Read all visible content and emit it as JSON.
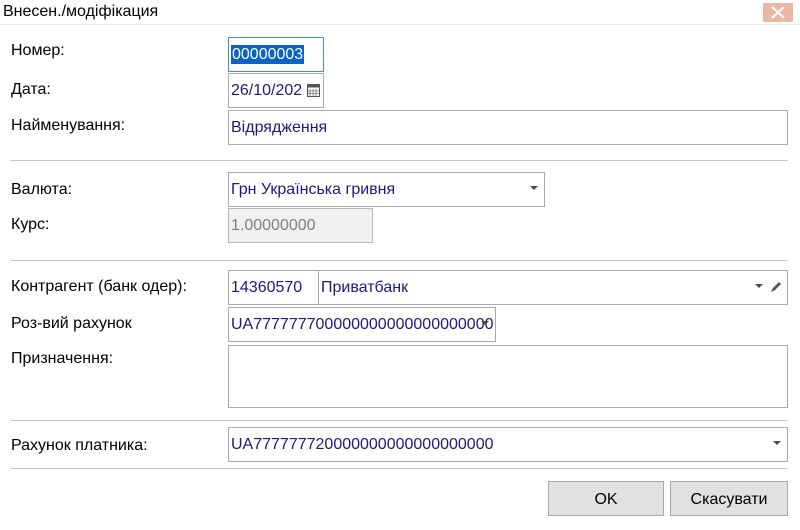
{
  "window": {
    "title": "Внесен./модіфікация"
  },
  "labels": {
    "number": "Номер:",
    "date": "Дата:",
    "name": "Найменування:",
    "currency": "Валюта:",
    "rate": "Курс:",
    "counterparty": "Контрагент (банк одер):",
    "settlement_account": "Роз-вий рахунок",
    "purpose": "Призначення:",
    "payer_account": "Рахунок платника:"
  },
  "values": {
    "number": "00000003",
    "date": "26/10/202",
    "name": "Відрядження",
    "currency": "Грн Українська гривня",
    "rate": "1.00000000",
    "counterparty_code": "14360570",
    "counterparty_name": "Приватбанк",
    "settlement_account": "UA777777700000000000000000000",
    "purpose": "",
    "payer_account": "UA777777720000000000000000000"
  },
  "buttons": {
    "ok": "OK",
    "cancel": "Скасувати"
  },
  "icons": {
    "close": "close-icon",
    "calendar": "calendar-icon",
    "dropdown": "chevron-down-icon",
    "edit": "pencil-icon"
  },
  "colors": {
    "close_button": "#e8b7a6",
    "selection": "#0a64c8",
    "value_text": "#1a1a80",
    "focus_border": "#3c8fd6"
  }
}
